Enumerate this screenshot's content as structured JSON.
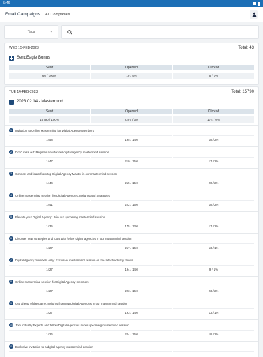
{
  "status": {
    "time": "5:46"
  },
  "appbar": {
    "title": "Email Campaigns",
    "subtitle": "All Companies"
  },
  "filters": {
    "tags_label": "Tags",
    "search_placeholder": ""
  },
  "day1": {
    "date": "WED 15-FEB-2023",
    "total_label": "Total:",
    "total": "43",
    "campaign": "SendEagle Bonus",
    "headers": [
      "Sent",
      "Opened",
      "Clicked"
    ],
    "values": [
      "66 / 100%",
      "19 / 9%",
      "6 / 0%"
    ]
  },
  "day2": {
    "date": "TUE 14-FEB-2023",
    "total_label": "Total:",
    "total": "15790",
    "campaign": "2023 02 14 - Mastermind",
    "headers": [
      "Sent",
      "Opened",
      "Clicked"
    ],
    "values": [
      "15790 / 100%",
      "2297 / 0%",
      "174 / 0%"
    ],
    "emails": [
      {
        "n": "1",
        "subject": "Invitation to Online Mastermind for Digital Agency Members",
        "sent": "1458",
        "opened": "195 / 14%",
        "clicked": "18 / 2%"
      },
      {
        "n": "2",
        "subject": "Don't miss out: Register now for our digital agency mastermind session",
        "sent": "1447",
        "opened": "210 / 15%",
        "clicked": "17 / 2%"
      },
      {
        "n": "3",
        "subject": "Connect and learn from top Digital Agency Master in our mastermind session",
        "sent": "1444",
        "opened": "215 / 15%",
        "clicked": "20 / 2%"
      },
      {
        "n": "4",
        "subject": "Online mastermind session for Digital Agencies: Insights and Strategies",
        "sent": "1441",
        "opened": "222 / 16%",
        "clicked": "18 / 2%"
      },
      {
        "n": "5",
        "subject": "Elevate your Digital Agency: Join our upcoming mastermind session",
        "sent": "1435",
        "opened": "175 / 13%",
        "clicked": "17 / 2%"
      },
      {
        "n": "6",
        "subject": "Discover new strategies and tools with fellow digital agencies in our mastermind session",
        "sent": "1427",
        "opened": "217 / 16%",
        "clicked": "13 / 1%"
      },
      {
        "n": "7",
        "subject": "Digital Agency members only: Exclusive mastermind session on the latest industry trends",
        "sent": "1427",
        "opened": "194 / 14%",
        "clicked": "9 / 1%"
      },
      {
        "n": "8",
        "subject": "Online mastermind session for Digital Agency members",
        "sent": "1427",
        "opened": "223 / 16%",
        "clicked": "23 / 2%"
      },
      {
        "n": "9",
        "subject": "Get ahead of the game: Insights from top Digital Agencies in our mastermind session",
        "sent": "1427",
        "opened": "193 / 14%",
        "clicked": "13 / 1%"
      },
      {
        "n": "10",
        "subject": "Join Industry Experts and fellow Digital Agencies in our upcoming mastermind session",
        "sent": "1426",
        "opened": "224 / 16%",
        "clicked": "18 / 2%"
      },
      {
        "n": "11",
        "subject": "Exclusive invitation to a digital agency mastermind session",
        "sent": "",
        "opened": "",
        "clicked": ""
      }
    ]
  },
  "colors": {
    "status_bar": "#1c6fb6",
    "accent": "#1f4a7a",
    "header_cell": "#dbe3ea"
  }
}
